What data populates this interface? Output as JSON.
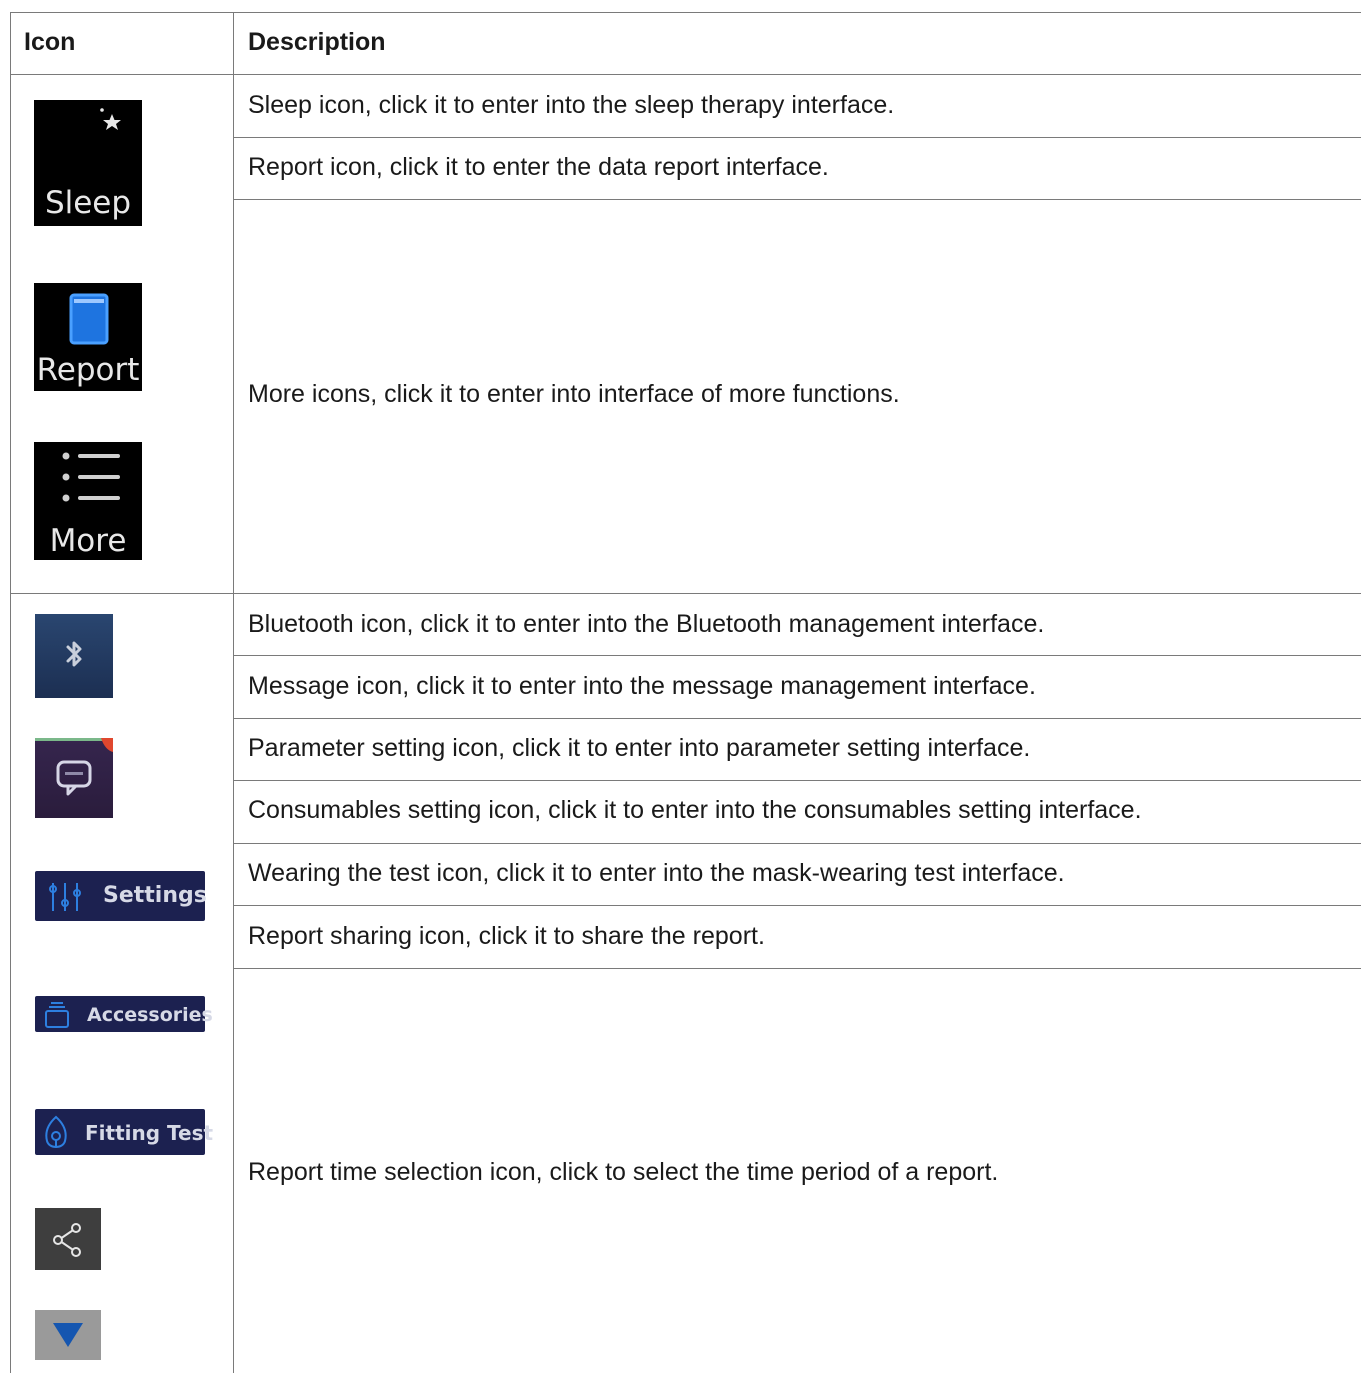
{
  "header": {
    "icon": "Icon",
    "description": "Description"
  },
  "group1": {
    "icons": [
      {
        "label": "Sleep",
        "icon": "moon-stars-icon"
      },
      {
        "label": "Report",
        "icon": "report-window-icon"
      },
      {
        "label": "More",
        "icon": "list-menu-icon"
      }
    ],
    "rows": [
      "Sleep icon, click it to enter into the sleep therapy interface.",
      "Report icon, click it to enter the data report interface.",
      "More icons, click it to enter into interface of more functions."
    ]
  },
  "group2": {
    "icons": [
      {
        "label": "",
        "icon": "bluetooth-icon"
      },
      {
        "label": "",
        "icon": "message-icon"
      },
      {
        "label": "Settings",
        "icon": "sliders-icon"
      },
      {
        "label": "Accessories",
        "icon": "accessories-icon"
      },
      {
        "label": "Fitting Test",
        "icon": "fitting-test-icon"
      },
      {
        "label": "",
        "icon": "share-icon"
      },
      {
        "label": "",
        "icon": "triangle-down-icon"
      }
    ],
    "rows": [
      "Bluetooth icon, click it to enter into the Bluetooth management interface.",
      "Message icon, click it to enter into the message management interface.",
      "Parameter setting icon, click it to enter into parameter setting interface.",
      "Consumables setting icon, click it to enter into the consumables setting interface.",
      "Wearing the test icon, click it to enter into the mask-wearing test interface.",
      "Report sharing icon, click it to share the report.",
      "Report time selection icon, click to select the time period of a report."
    ]
  },
  "colors": {
    "tile_black": "#000000",
    "navy_button": "#1c2150",
    "bluetooth_tile": "#22395f",
    "message_tile": "#2d2042",
    "badge_red": "#e0472e",
    "accent_blue": "#2d7fe0",
    "share_tile": "#3e3e3e",
    "dropdown_tile": "#9a9a9a",
    "dropdown_arrow": "#1556b0"
  }
}
